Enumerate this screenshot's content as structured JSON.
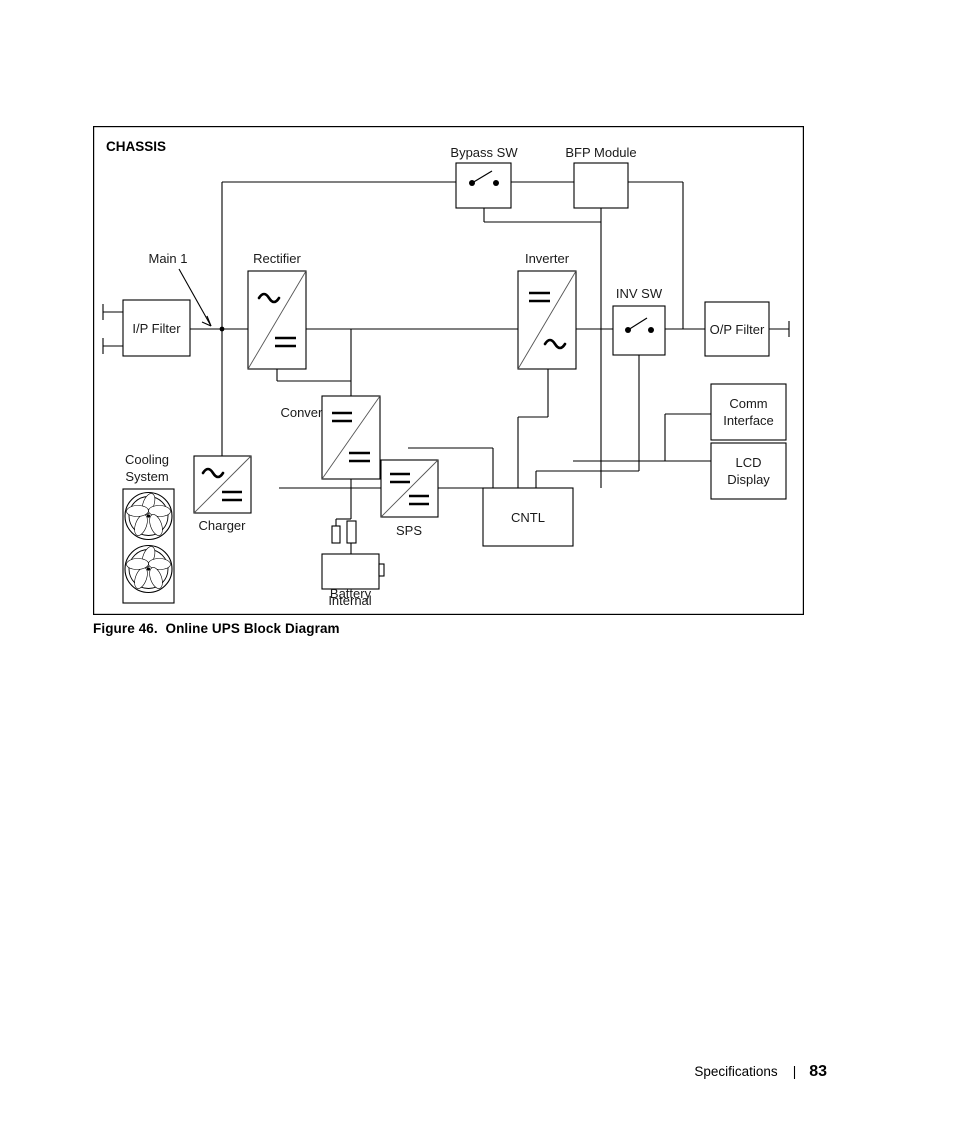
{
  "page": {
    "figure_caption": "Figure 46.  Online UPS Block Diagram",
    "footer_section": "Specifications",
    "footer_separator": "|",
    "footer_page_number": "83"
  },
  "diagram": {
    "title": "CHASSIS",
    "type": "block-diagram",
    "annotations": [
      {
        "id": "main1",
        "label": "Main 1",
        "target": "input-node"
      }
    ],
    "blocks": [
      {
        "id": "ip-filter",
        "label": "I/P Filter",
        "symbol": "none",
        "label_position": "inside"
      },
      {
        "id": "rectifier",
        "label": "Rectifier",
        "symbol": "ac-to-dc",
        "label_position": "above"
      },
      {
        "id": "inverter",
        "label": "Inverter",
        "symbol": "dc-to-ac",
        "label_position": "above"
      },
      {
        "id": "bypass-sw",
        "label": "Bypass SW",
        "symbol": "switch",
        "label_position": "above"
      },
      {
        "id": "bfp-module",
        "label": "BFP Module",
        "symbol": "none",
        "label_position": "above"
      },
      {
        "id": "inv-sw",
        "label": "INV SW",
        "symbol": "switch",
        "label_position": "above"
      },
      {
        "id": "op-filter",
        "label": "O/P Filter",
        "symbol": "none",
        "label_position": "inside"
      },
      {
        "id": "converter",
        "label": "Converter",
        "symbol": "dc-to-dc",
        "label_position": "left"
      },
      {
        "id": "charger",
        "label": "Charger",
        "symbol": "ac-to-dc",
        "label_position": "below"
      },
      {
        "id": "sps",
        "label": "SPS",
        "symbol": "dc-to-dc",
        "label_position": "below"
      },
      {
        "id": "cntl",
        "label": "CNTL",
        "symbol": "none",
        "label_position": "inside"
      },
      {
        "id": "comm-interface",
        "label_line1": "Comm",
        "label_line2": "Interface",
        "symbol": "none",
        "label_position": "inside"
      },
      {
        "id": "lcd-display",
        "label_line1": "LCD",
        "label_line2": "Display",
        "symbol": "none",
        "label_position": "inside"
      },
      {
        "id": "cooling-system",
        "label_line1": "Cooling",
        "label_line2": "System",
        "symbol": "fans",
        "label_position": "above"
      },
      {
        "id": "internal-battery",
        "label_line1": "Internal",
        "label_line2": "Battery",
        "symbol": "battery",
        "label_position": "below"
      }
    ],
    "symbols": {
      "ac": "~",
      "dc": "=",
      "fan_count": 2
    },
    "colors": {
      "line": "#000000",
      "text": "#1a1a1a",
      "background": "#ffffff"
    }
  }
}
